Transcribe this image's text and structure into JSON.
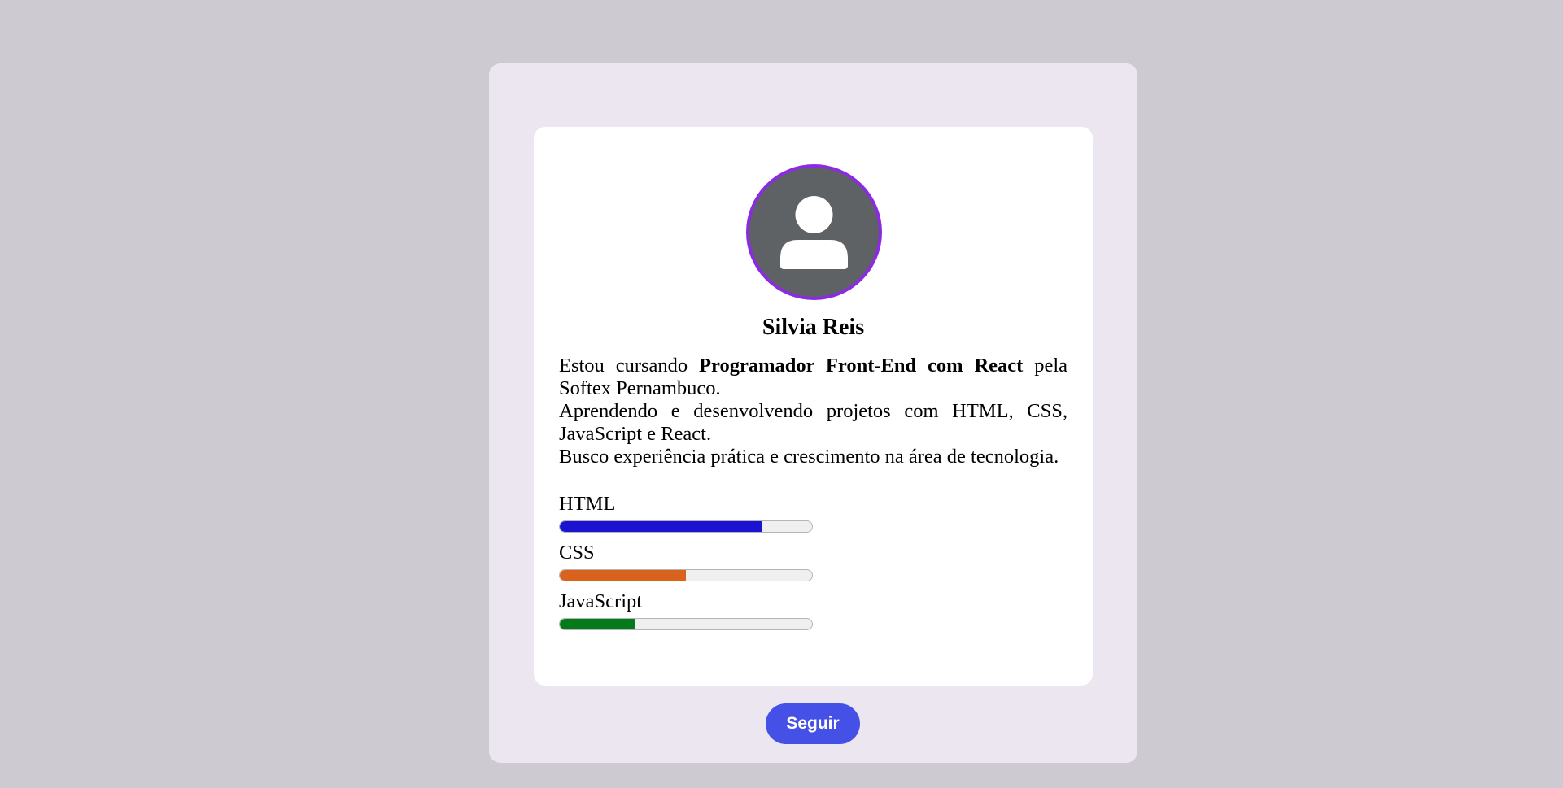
{
  "profile": {
    "name": "Silvia Reis",
    "bio": {
      "line1_prefix": "Estou cursando ",
      "line1_course": "Programador Front-End com React",
      "line1_suffix": " pela Softex Pernambuco.",
      "line2": "Aprendendo e desenvolvendo projetos com HTML, CSS, JavaScript e React.",
      "line3": "Busco experiência prática e crescimento na área de tecnologia."
    },
    "avatar_icon": "user-silhouette-icon"
  },
  "skills": [
    {
      "label": "HTML",
      "level": 0.8,
      "color": "#1b13d1"
    },
    {
      "label": "CSS",
      "level": 0.5,
      "color": "#d9631c"
    },
    {
      "label": "JavaScript",
      "level": 0.3,
      "color": "#047a1b"
    }
  ],
  "actions": {
    "follow_label": "Seguir"
  },
  "colors": {
    "page_background": "#cdcbd1",
    "outer_card": "#ece6f1",
    "avatar_border": "#8a2be2",
    "button": "#4450e6"
  }
}
